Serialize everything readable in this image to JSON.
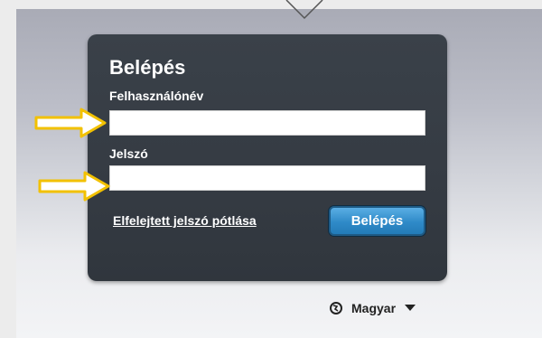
{
  "login": {
    "title": "Belépés",
    "username_label": "Felhasználónév",
    "username_value": "",
    "password_label": "Jelszó",
    "password_value": "",
    "forgot_link": "Elfelejtett jelszó pótlása",
    "submit_label": "Belépés"
  },
  "language": {
    "selected": "Magyar",
    "icon": "globe-icon",
    "dropdown_icon": "caret-down-icon"
  },
  "annotations": {
    "arrow_icon": "arrow-right-icon",
    "arrow_color": "#f2c100"
  },
  "colors": {
    "panel": "#353b43",
    "button": "#2f8ac8",
    "text": "#ffffff"
  }
}
